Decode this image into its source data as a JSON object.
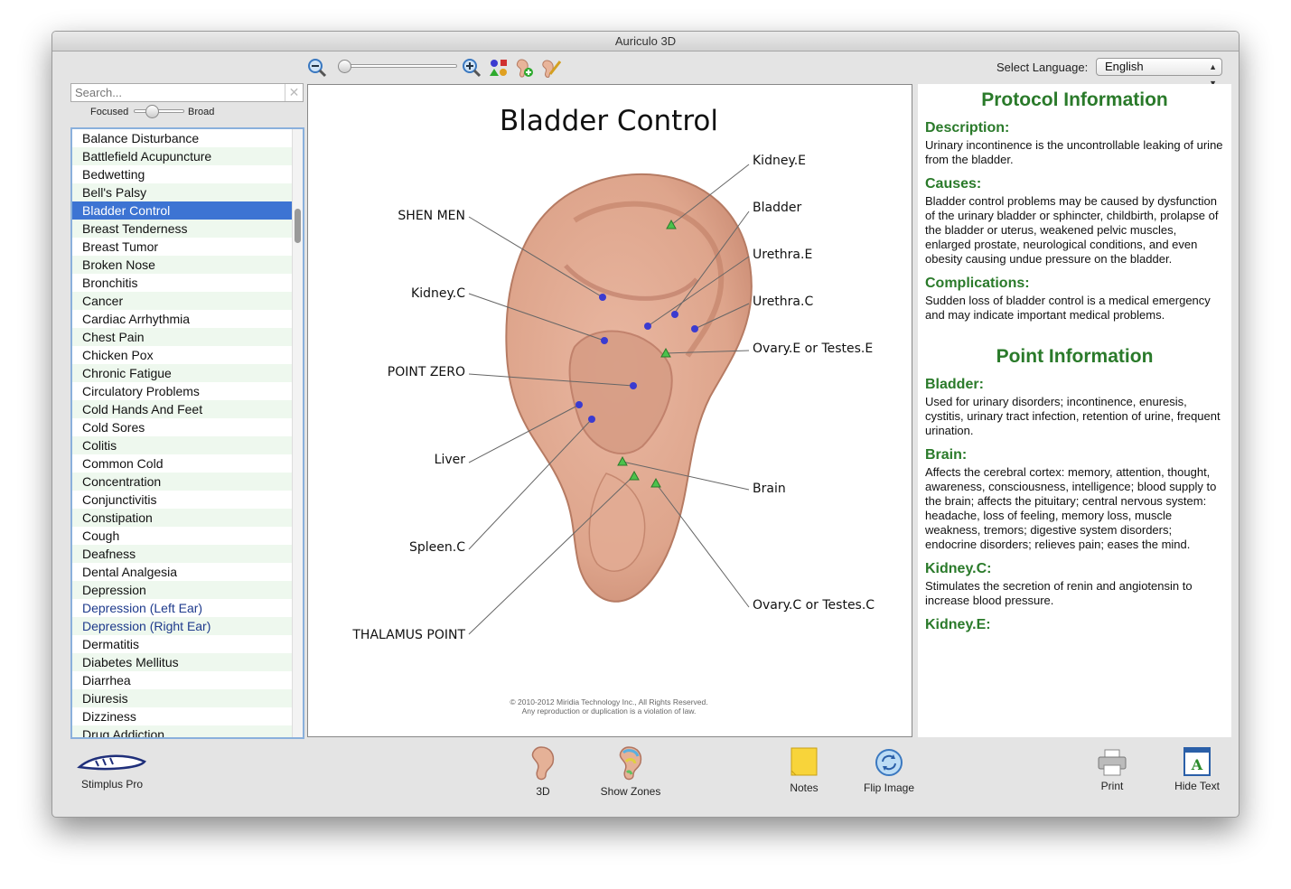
{
  "window": {
    "title": "Auriculo 3D"
  },
  "toolbar": {
    "language_label": "Select Language:",
    "language_value": "English"
  },
  "search": {
    "placeholder": "Search...",
    "focused_label": "Focused",
    "broad_label": "Broad"
  },
  "conditions": [
    {
      "label": "Balance Disturbance"
    },
    {
      "label": "Battlefield Acupuncture"
    },
    {
      "label": "Bedwetting"
    },
    {
      "label": "Bell's Palsy"
    },
    {
      "label": "Bladder Control",
      "selected": true
    },
    {
      "label": "Breast Tenderness"
    },
    {
      "label": "Breast Tumor"
    },
    {
      "label": "Broken Nose"
    },
    {
      "label": "Bronchitis"
    },
    {
      "label": "Cancer"
    },
    {
      "label": "Cardiac Arrhythmia"
    },
    {
      "label": "Chest Pain"
    },
    {
      "label": "Chicken Pox"
    },
    {
      "label": "Chronic Fatigue"
    },
    {
      "label": "Circulatory Problems"
    },
    {
      "label": "Cold Hands And Feet"
    },
    {
      "label": "Cold Sores"
    },
    {
      "label": "Colitis"
    },
    {
      "label": "Common Cold"
    },
    {
      "label": "Concentration"
    },
    {
      "label": "Conjunctivitis"
    },
    {
      "label": "Constipation"
    },
    {
      "label": "Cough"
    },
    {
      "label": "Deafness"
    },
    {
      "label": "Dental Analgesia"
    },
    {
      "label": "Depression"
    },
    {
      "label": "Depression (Left Ear)",
      "blue": true
    },
    {
      "label": "Depression (Right Ear)",
      "blue": true
    },
    {
      "label": "Dermatitis"
    },
    {
      "label": "Diabetes Mellitus"
    },
    {
      "label": "Diarrhea"
    },
    {
      "label": "Diuresis"
    },
    {
      "label": "Dizziness"
    },
    {
      "label": "Drug Addiction"
    }
  ],
  "diagram": {
    "title": "Bladder Control",
    "labels": {
      "kidney_e": "Kidney.E",
      "bladder": "Bladder",
      "urethra_e": "Urethra.E",
      "urethra_c": "Urethra.C",
      "ovary_e": "Ovary.E or Testes.E",
      "brain": "Brain",
      "ovary_c": "Ovary.C or Testes.C",
      "shen_men": "SHEN MEN",
      "kidney_c": "Kidney.C",
      "point_zero": "POINT ZERO",
      "liver": "Liver",
      "spleen_c": "Spleen.C",
      "thalamus": "THALAMUS POINT"
    },
    "copyright1": "© 2010-2012 Miridia Technology Inc., All Rights Reserved.",
    "copyright2": "Any reproduction or duplication is a violation of law."
  },
  "info": {
    "protocol_title": "Protocol Information",
    "description_h": "Description:",
    "description": "Urinary incontinence is the uncontrollable leaking of urine from the bladder.",
    "causes_h": "Causes:",
    "causes": "Bladder control problems may be caused by dysfunction of the urinary bladder or sphincter, childbirth, prolapse of the bladder or uterus, weakened pelvic muscles, enlarged prostate, neurological conditions, and even obesity causing undue pressure on the bladder.",
    "complications_h": "Complications:",
    "complications": "Sudden loss of bladder control is a medical emergency and may indicate important medical problems.",
    "point_title": "Point Information",
    "bladder_h": "Bladder:",
    "bladder": "Used for urinary disorders; incontinence, enuresis, cystitis, urinary tract infection, retention of urine, frequent urination.",
    "brain_h": "Brain:",
    "brain": "Affects the cerebral cortex: memory, attention, thought, awareness, consciousness, intelligence; blood supply to the brain; affects the pituitary; central nervous system: headache, loss of feeling, memory loss, muscle weakness, tremors; digestive system disorders; endocrine disorders; relieves pain; eases the mind.",
    "kidneyc_h": "Kidney.C:",
    "kidneyc": "Stimulates the secretion of renin and angiotensin to increase blood pressure.",
    "kidneye_h": "Kidney.E:"
  },
  "bottom": {
    "stimplus": "Stimplus Pro",
    "btn_3d": "3D",
    "show_zones": "Show Zones",
    "notes": "Notes",
    "flip": "Flip Image",
    "print": "Print",
    "hide_text": "Hide Text"
  }
}
